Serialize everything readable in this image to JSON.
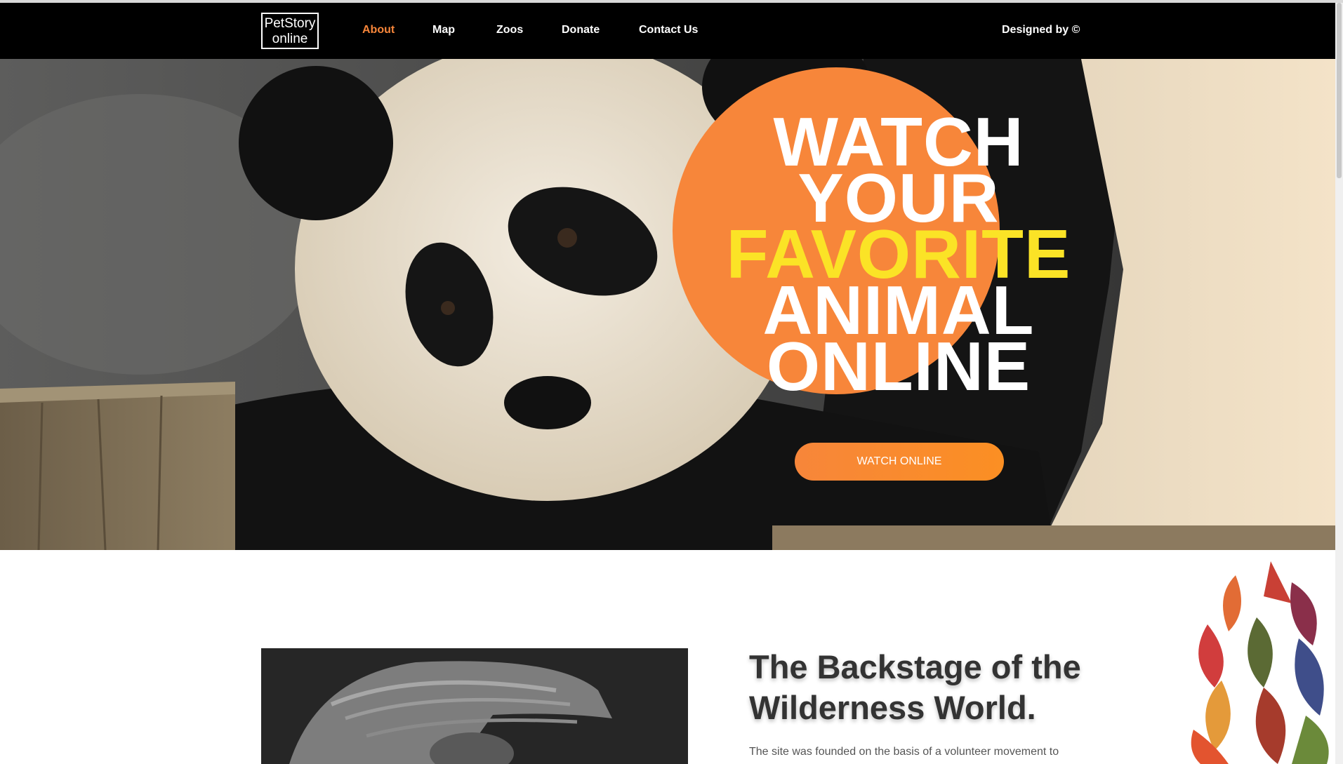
{
  "nav": {
    "logo_line1": "PetStory",
    "logo_line2": "online",
    "links": [
      {
        "label": "About",
        "active": true
      },
      {
        "label": "Map",
        "active": false
      },
      {
        "label": "Zoos",
        "active": false
      },
      {
        "label": "Donate",
        "active": false
      },
      {
        "label": "Contact Us",
        "active": false
      }
    ],
    "designed_by": "Designed by ©"
  },
  "hero": {
    "title_lines": [
      "WATCH",
      "YOUR",
      "FAVORITE",
      "ANIMAL",
      "ONLINE"
    ],
    "highlight_line": "FAVORITE",
    "button_label": "WATCH ONLINE"
  },
  "about": {
    "title": "The Backstage of the Wilderness World.",
    "text": "The site was founded on the basis of a volunteer movement to protect rare forms of animals."
  },
  "colors": {
    "accent": "#f7863a",
    "highlight": "#fbe326",
    "nav_bg": "#000000",
    "text_dark": "#333333"
  },
  "icons": {
    "cursor": "mouse-pointer-icon"
  }
}
